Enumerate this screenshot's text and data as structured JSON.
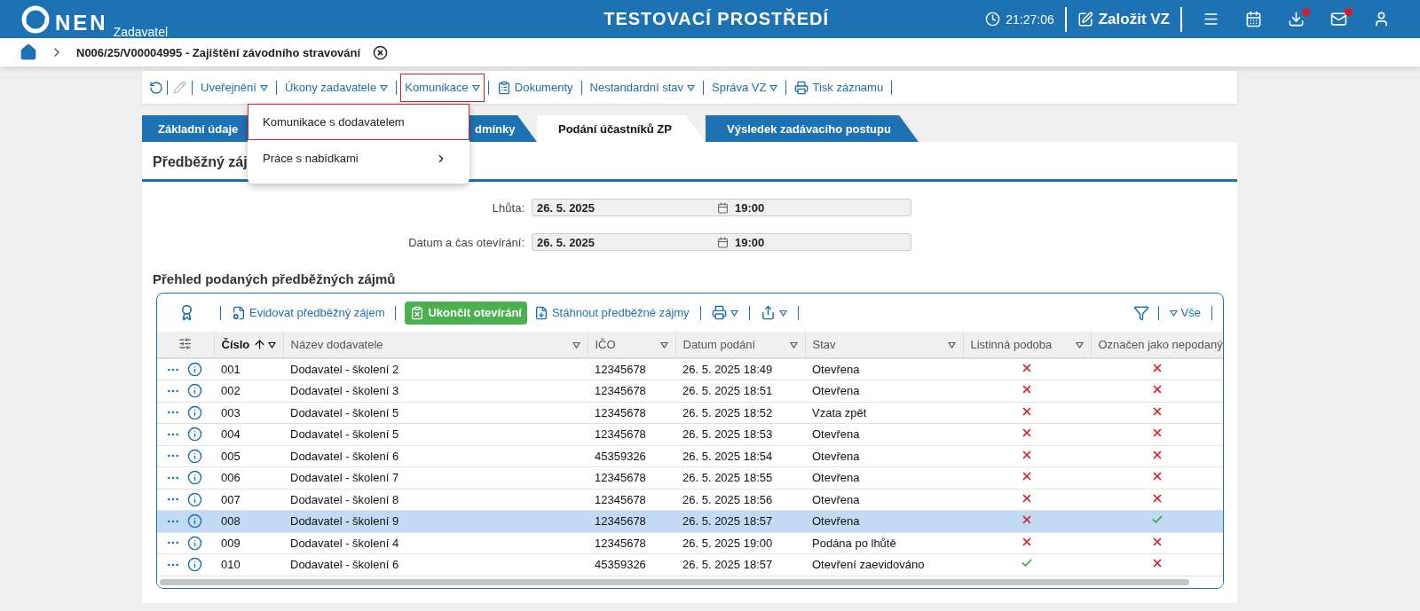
{
  "header": {
    "logo": "NEN",
    "role": "Zadavatel",
    "environment": "TESTOVACÍ PROSTŘEDÍ",
    "clock": "21:27:06",
    "create_button": "Založit VZ",
    "notifications": [
      {
        "kind": "menu",
        "badge": false
      },
      {
        "kind": "calendar",
        "badge": false
      },
      {
        "kind": "download",
        "badge": true
      },
      {
        "kind": "mail",
        "badge": true
      },
      {
        "kind": "user",
        "badge": false
      }
    ]
  },
  "breadcrumb": {
    "title": "N006/25/V00004995 - Zajištění závodního stravování"
  },
  "toolbar": {
    "items": [
      {
        "label": "Uveřejnění",
        "dropdown": true,
        "open": false
      },
      {
        "label": "Úkony zadavatele",
        "dropdown": true,
        "open": false
      },
      {
        "label": "Komunikace",
        "dropdown": true,
        "open": true
      },
      {
        "label": "Dokumenty",
        "dropdown": false,
        "open": false
      },
      {
        "label": "Nestandardní stav",
        "dropdown": true,
        "open": false
      },
      {
        "label": "Správa VZ",
        "dropdown": true,
        "open": false
      },
      {
        "label": "Tisk záznamu",
        "dropdown": false,
        "open": false
      }
    ]
  },
  "dropdown_menu": {
    "items": [
      {
        "label": "Komunikace s dodavatelem",
        "highlighted": true,
        "submenu": false
      },
      {
        "label": "Práce s nabídkami",
        "highlighted": false,
        "submenu": true
      }
    ]
  },
  "tabs": [
    {
      "label": "Základní údaje",
      "selected": false
    },
    {
      "label": "dmínky",
      "selected": false
    },
    {
      "label": "Podání účastníků ZP",
      "selected": true
    },
    {
      "label": "Výsledek zadávacího postupu",
      "selected": false
    }
  ],
  "section_title": "Předběžný záj",
  "fields": [
    {
      "label": "Lhůta:",
      "date": "26. 5. 2025",
      "time": "19:00"
    },
    {
      "label": "Datum a čas otevírání:",
      "date": "26. 5. 2025",
      "time": "19:00"
    }
  ],
  "table_title": "Přehled podaných předběžných zájmů",
  "table_toolbar": {
    "actions": [
      {
        "label": "Evidovat předběžný zájem",
        "kind": "link"
      },
      {
        "label": "Ukončit otevírání",
        "kind": "primary"
      },
      {
        "label": "Stáhnout předběžné zájmy",
        "kind": "link"
      }
    ],
    "filter_label": "Vše"
  },
  "table": {
    "columns": [
      {
        "label": "Číslo",
        "sorted": true,
        "filter": true
      },
      {
        "label": "Název dodavatele",
        "sorted": false,
        "filter": true
      },
      {
        "label": "IČO",
        "sorted": false,
        "filter": true
      },
      {
        "label": "Datum podání",
        "sorted": false,
        "filter": true
      },
      {
        "label": "Stav",
        "sorted": false,
        "filter": true
      },
      {
        "label": "Listinná podoba",
        "sorted": false,
        "filter": true
      },
      {
        "label": "Označen jako nepodaný",
        "sorted": false
      }
    ],
    "rows": [
      {
        "number": "001",
        "supplier": "Dodavatel - školení 2",
        "ico": "12345678",
        "submitted": "26. 5. 2025 18:49",
        "status": "Otevřena",
        "paper_form": false,
        "marked_unsubmitted": false,
        "selected": false
      },
      {
        "number": "002",
        "supplier": "Dodavatel - školení 3",
        "ico": "12345678",
        "submitted": "26. 5. 2025 18:51",
        "status": "Otevřena",
        "paper_form": false,
        "marked_unsubmitted": false,
        "selected": false
      },
      {
        "number": "003",
        "supplier": "Dodavatel - školení 5",
        "ico": "12345678",
        "submitted": "26. 5. 2025 18:52",
        "status": "Vzata zpět",
        "paper_form": false,
        "marked_unsubmitted": false,
        "selected": false
      },
      {
        "number": "004",
        "supplier": "Dodavatel - školení 5",
        "ico": "12345678",
        "submitted": "26. 5. 2025 18:53",
        "status": "Otevřena",
        "paper_form": false,
        "marked_unsubmitted": false,
        "selected": false
      },
      {
        "number": "005",
        "supplier": "Dodavatel - školení 6",
        "ico": "45359326",
        "submitted": "26. 5. 2025 18:54",
        "status": "Otevřena",
        "paper_form": false,
        "marked_unsubmitted": false,
        "selected": false
      },
      {
        "number": "006",
        "supplier": "Dodavatel - školení 7",
        "ico": "12345678",
        "submitted": "26. 5. 2025 18:55",
        "status": "Otevřena",
        "paper_form": false,
        "marked_unsubmitted": false,
        "selected": false
      },
      {
        "number": "007",
        "supplier": "Dodavatel - školení 8",
        "ico": "12345678",
        "submitted": "26. 5. 2025 18:56",
        "status": "Otevřena",
        "paper_form": false,
        "marked_unsubmitted": false,
        "selected": false
      },
      {
        "number": "008",
        "supplier": "Dodavatel - školení 9",
        "ico": "12345678",
        "submitted": "26. 5. 2025 18:57",
        "status": "Otevřena",
        "paper_form": false,
        "marked_unsubmitted": true,
        "selected": true
      },
      {
        "number": "009",
        "supplier": "Dodavatel - školení 4",
        "ico": "12345678",
        "submitted": "26. 5. 2025 19:00",
        "status": "Podána po lhůtě",
        "paper_form": false,
        "marked_unsubmitted": false,
        "selected": false
      },
      {
        "number": "010",
        "supplier": "Dodavatel - školení 6",
        "ico": "45359326",
        "submitted": "26. 5. 2025 18:57",
        "status": "Otevření zaevidováno",
        "paper_form": true,
        "marked_unsubmitted": false,
        "selected": false
      }
    ]
  }
}
